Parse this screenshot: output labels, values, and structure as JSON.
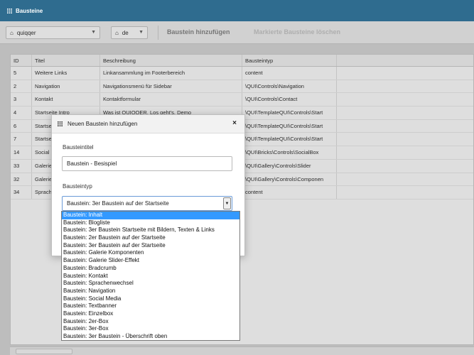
{
  "window": {
    "title": "Bausteine"
  },
  "toolbar": {
    "project_select": "quiqqer",
    "lang_select": "de",
    "add_button": "Baustein hinzufügen",
    "delete_button": "Markierte Bausteine löschen"
  },
  "grid": {
    "columns": [
      "ID",
      "Titel",
      "Beschreibung",
      "Bausteintyp"
    ],
    "rows": [
      [
        "5",
        "Weitere Links",
        "Linkansammlung im Footerbereich",
        "content"
      ],
      [
        "2",
        "Navigation",
        "Navigationsmenü für Sidebar",
        "\\QUI\\Controls\\Navigation"
      ],
      [
        "3",
        "Kontakt",
        "Kontaktformular",
        "\\QUI\\Controls\\Contact"
      ],
      [
        "4",
        "Startseite Intro",
        "Was ist QUIQQER, Los geht's, Demo",
        "\\QUI\\TemplateQUI\\Controls\\Start"
      ],
      [
        "6",
        "Startse",
        "",
        "\\QUI\\TemplateQUI\\Controls\\Start"
      ],
      [
        "7",
        "Startse",
        "",
        "\\QUI\\TemplateQUI\\Controls\\Start"
      ],
      [
        "14",
        "Social",
        "",
        "\\QUI\\Bricks\\Controls\\SocialBox"
      ],
      [
        "33",
        "Galerie",
        "",
        "\\QUI\\Gallery\\Controls\\Slider"
      ],
      [
        "32",
        "Galerie",
        "",
        "\\QUI\\Gallery\\Controls\\Componen"
      ],
      [
        "34",
        "Sprach",
        "",
        "content"
      ]
    ]
  },
  "modal": {
    "title": "Neuen Baustein hinzufügen",
    "close_icon": "×",
    "title_label": "Bausteintitel",
    "title_value": "Baustein - Besispiel",
    "type_label": "Bausteintyp",
    "type_selected": "Baustein: 3er Baustein auf der Startseite",
    "type_arrow": "▼"
  },
  "dropdown": {
    "options": [
      "Baustein: Inhalt",
      "Baustein: Blogliste",
      "Baustein: 3er Baustein Startseite mit Bildern, Texten & Links",
      "Baustein: 2er Baustein auf der Startseite",
      "Baustein: 3er Baustein auf der Startseite",
      "Baustein: Galerie Komponenten",
      "Baustein: Galerie Slider-Effekt",
      "Baustein: Bradcrumb",
      "Baustein: Kontakt",
      "Baustein: Sprachenwechsel",
      "Baustein: Navigation",
      "Baustein: Social Media",
      "Baustein: Textbanner",
      "Baustein: Einzelbox",
      "Baustein: 2er-Box",
      "Baustein: 3er-Box",
      "Baustein: 3er Baustein - Überschrift oben"
    ],
    "highlighted_index": 0
  },
  "icons": {
    "grid_icon": "grid-icon",
    "home_icon": "home-icon",
    "caret_icon": "caret-down-icon",
    "close_icon": "close-icon"
  },
  "colors": {
    "titlebar": "#2f6c8f",
    "selection": "#3399ff",
    "focus_border": "#6a9bd8"
  }
}
